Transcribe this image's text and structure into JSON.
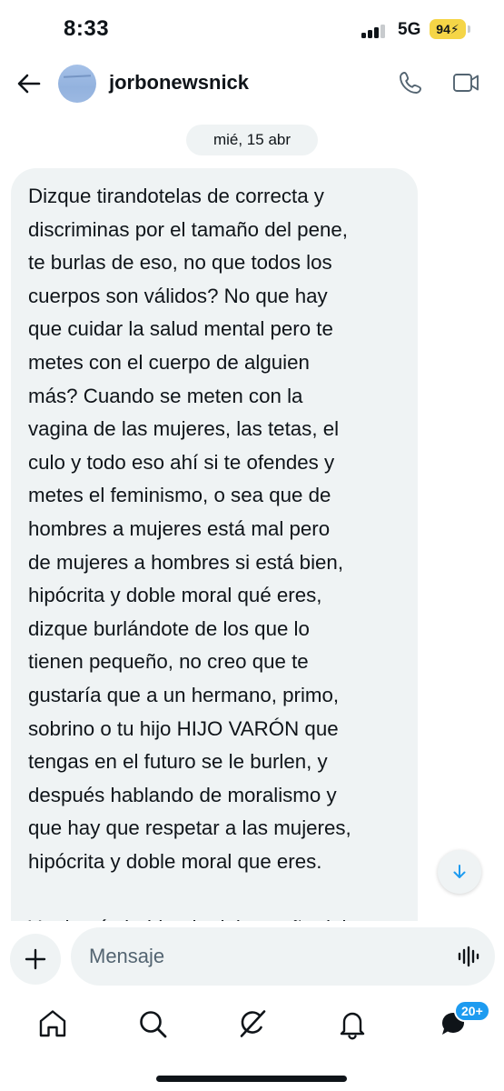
{
  "status_bar": {
    "time": "8:33",
    "network": "5G",
    "battery": "94"
  },
  "header": {
    "contact_name": "jorbonewsnick",
    "back_icon": "arrow-left-icon",
    "call_icon": "phone-icon",
    "video_icon": "video-camera-icon"
  },
  "conversation": {
    "date": "mié, 15 abr",
    "message_lines": [
      "Dizque tirandotelas de correcta y",
      "discriminas por el tamaño del pene,",
      "te burlas de eso, no que todos los",
      "cuerpos son válidos? No que hay",
      "que cuidar la salud mental pero te",
      "metes con el cuerpo de alguien",
      "más? Cuando se meten con la",
      "vagina de las mujeres, las tetas, el",
      "culo y todo eso ahí si te ofendes y",
      "metes el feminismo, o sea que de",
      "hombres a mujeres está mal pero",
      "de mujeres a hombres si está bien,",
      "hipócrita y doble moral qué eres,",
      "dizque burlándote de los que lo",
      "tienen pequeño, no creo que te",
      "gustaría que a un hermano, primo,",
      "sobrino o tu hijo HIJO VARÓN que",
      "tengas en el futuro se le burlen, y",
      "después hablando de moralismo y",
      "que hay que respetar a las mujeres,",
      "hipócrita y doble moral que eres."
    ],
    "next_line_partial": "Y además hablando del tamaño del"
  },
  "composer": {
    "placeholder": "Mensaje",
    "add_icon": "plus-icon",
    "voice_icon": "voice-waveform-icon"
  },
  "bottom_nav": {
    "items": [
      "home-icon",
      "search-icon",
      "grok-icon",
      "bell-icon",
      "messages-icon"
    ],
    "messages_badge": "20+"
  },
  "colors": {
    "bubble": "#eff3f4",
    "accent": "#1d9bf0",
    "text": "#0f1419",
    "battery": "#f5d547"
  }
}
